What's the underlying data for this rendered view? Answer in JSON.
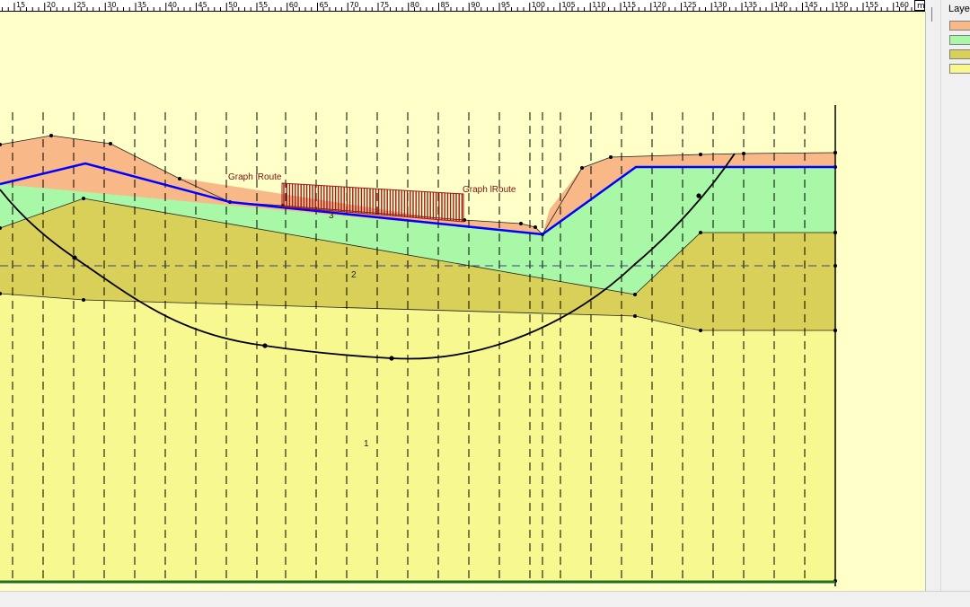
{
  "ruler": {
    "ticks": [
      "15",
      "20",
      "25",
      "30",
      "35",
      "40",
      "45",
      "50",
      "55",
      "60",
      "65",
      "70",
      "75",
      "80",
      "85",
      "90",
      "95",
      "100",
      "105",
      "110",
      "115",
      "120",
      "125",
      "130",
      "135",
      "140",
      "145",
      "150",
      "155",
      "160"
    ],
    "unit": "m"
  },
  "legend": {
    "title": "Layer",
    "colors": [
      "#f8b888",
      "#a8f8a8",
      "#d8d058",
      "#f8f890"
    ]
  },
  "canvas": {
    "layer_labels": [
      "1",
      "2",
      "3"
    ],
    "graph_labels": [
      "Graph lRoute",
      "Graph lRoute"
    ],
    "colors": {
      "background": "#ffffc8",
      "layer_sand": "#f8b888",
      "layer_green": "#a8f8a8",
      "layer_olive": "#d8d058",
      "layer_yellow": "#f8f890",
      "phreatic": "#0000ff",
      "slip_circle": "#000000",
      "load": "#a01818",
      "base_line": "#207020",
      "label": "#7a1010"
    }
  }
}
